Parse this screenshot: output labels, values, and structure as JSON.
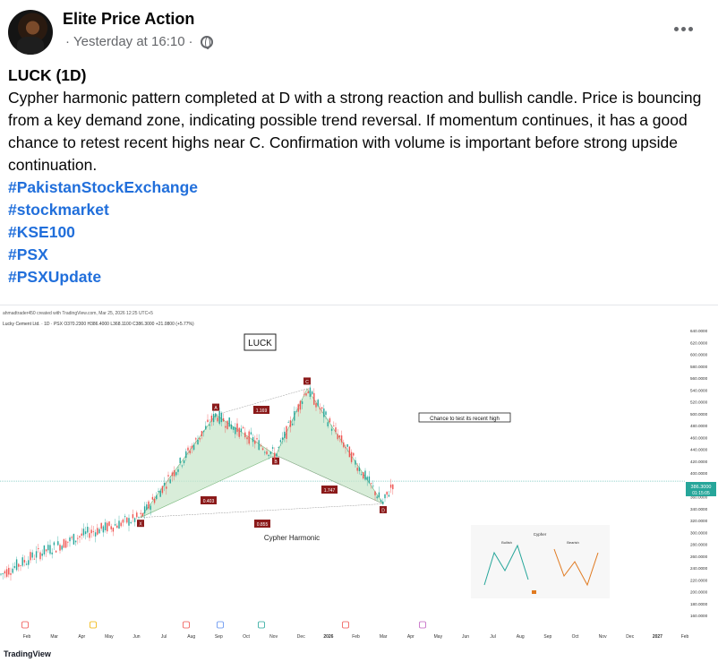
{
  "post": {
    "author": "Elite Price Action",
    "timestamp": "Yesterday at 16:10",
    "separator": "·",
    "more_icon": "more-horizontal-icon",
    "audience_icon": "globe-icon",
    "title": "LUCK (1D)",
    "body": "Cypher harmonic pattern completed at D with a strong reaction and bullish candle. Price is bouncing from a key demand zone, indicating possible trend reversal. If momentum continues, it has a good chance to retest recent highs near C. Confirmation with volume is important before strong upside continuation.",
    "hashtags": [
      "#PakistanStockExchange",
      "#stockmarket",
      "#KSE100",
      "#PSX",
      "#PSXUpdate"
    ]
  },
  "chart_image": {
    "header_line": "ahmadtrader450 created with TradingView.com, Mar 25, 2026 12:25 UTC+5",
    "symbol_line": "Lucky Cement Ltd. · 1D · PSX  O370.2300 H386.4000 L368.1100 C386.3000 +21.0800 (+5.77%)",
    "ticker_box": "LUCK",
    "note_box": "Chance to test its recent high",
    "pattern_label": "Cypher Harmonic",
    "ratio_labels": {
      "xa_c": "1.169",
      "xb": "0.403",
      "bd": "1.747",
      "xd": "0.855"
    },
    "point_labels": {
      "x": "X",
      "a": "A",
      "b": "B",
      "c": "C",
      "d": "D"
    },
    "price_tag": "386.3000",
    "price_tag_time": "01:15:05",
    "footer": "TradingView",
    "chart_data": {
      "type": "candlestick",
      "symbol": "LUCK",
      "y_axis_ticks": [
        "640.0000",
        "620.0000",
        "600.0000",
        "580.0000",
        "560.0000",
        "540.0000",
        "520.0000",
        "500.0000",
        "480.0000",
        "460.0000",
        "440.0000",
        "420.0000",
        "400.0000",
        "380.0000",
        "360.0000",
        "340.0000",
        "320.0000",
        "300.0000",
        "280.0000",
        "260.0000",
        "240.0000",
        "220.0000",
        "200.0000",
        "180.0000",
        "160.0000"
      ],
      "x_axis_ticks": [
        "Feb",
        "Mar",
        "Apr",
        "May",
        "Jun",
        "Jul",
        "Aug",
        "Sep",
        "Oct",
        "Nov",
        "Dec",
        "2026",
        "Feb",
        "Mar",
        "Apr",
        "May",
        "Jun",
        "Jul",
        "Aug",
        "Sep",
        "Oct",
        "Nov",
        "Dec",
        "2027",
        "Feb"
      ],
      "ylim": [
        160,
        640
      ],
      "pattern_points": [
        {
          "label": "X",
          "price": 325
        },
        {
          "label": "A",
          "price": 498
        },
        {
          "label": "B",
          "price": 430
        },
        {
          "label": "C",
          "price": 542
        },
        {
          "label": "D",
          "price": 348
        }
      ],
      "last_price": 386.3,
      "inset": {
        "title": "Cypher",
        "bullish": "Bullish",
        "bearish": "Bearish"
      }
    }
  },
  "colors": {
    "hashtag": "#216fdb",
    "up_candle": "#26a69a",
    "down_candle": "#ef5350",
    "pattern_fill": "#c8e6c9",
    "label_bg": "#8b1a1a"
  }
}
